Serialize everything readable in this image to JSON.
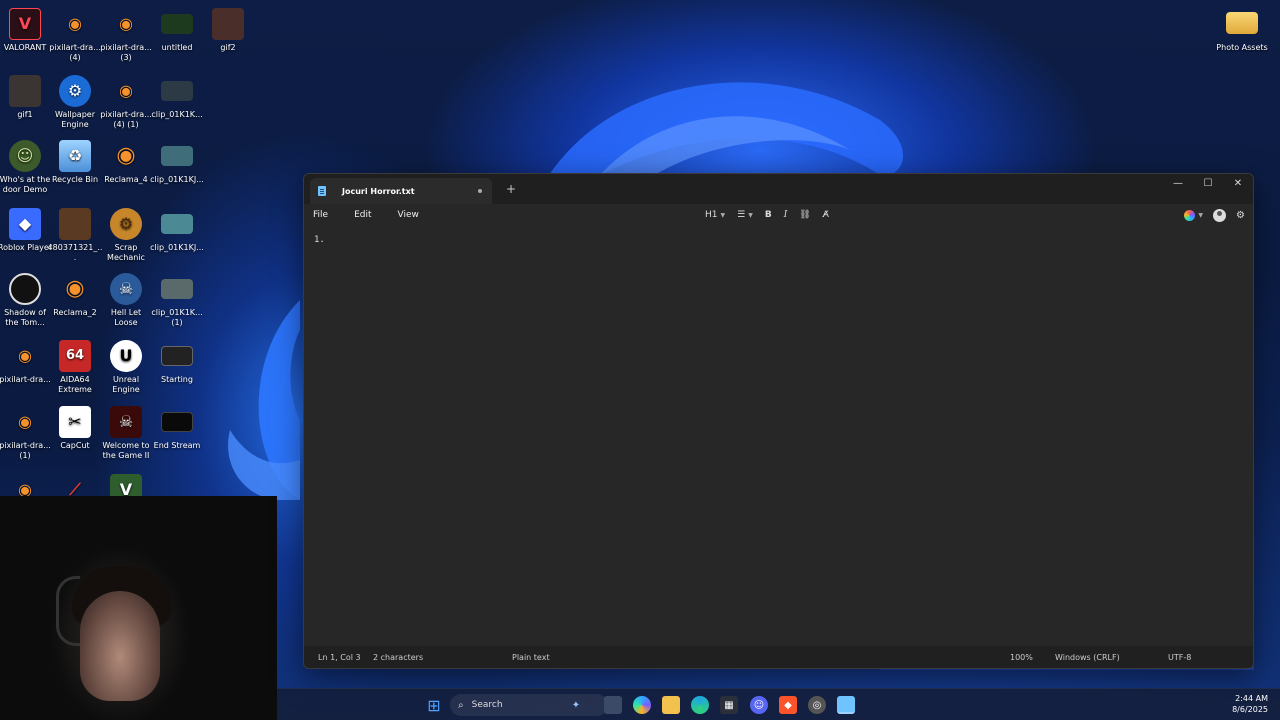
{
  "desktop": {
    "icons": [
      {
        "label": "VALORANT",
        "icon": "valorant-icon"
      },
      {
        "label": "pixilart-dra... (4)",
        "icon": "blender-icon"
      },
      {
        "label": "pixilart-dra... (3)",
        "icon": "blender-icon"
      },
      {
        "label": "untitled",
        "icon": "image-thumb"
      },
      {
        "label": "gif2",
        "icon": "image-thumb"
      },
      {
        "label": "gif1",
        "icon": "image-thumb"
      },
      {
        "label": "Wallpaper Engine",
        "icon": "wallpaper-engine-icon"
      },
      {
        "label": "pixilart-dra... (4) (1)",
        "icon": "blender-icon"
      },
      {
        "label": "clip_01K1K...",
        "icon": "video-thumb"
      },
      {
        "label": "Who's at the door Demo",
        "icon": "game-icon"
      },
      {
        "label": "Recycle Bin",
        "icon": "recycle-bin-icon"
      },
      {
        "label": "Reclama_4",
        "icon": "blender-icon"
      },
      {
        "label": "clip_01K1KJ...",
        "icon": "video-thumb"
      },
      {
        "label": "Roblox Player",
        "icon": "roblox-icon"
      },
      {
        "label": "480371321_...",
        "icon": "image-thumb"
      },
      {
        "label": "Scrap Mechanic",
        "icon": "scrap-mechanic-icon"
      },
      {
        "label": "clip_01K1KJ...",
        "icon": "video-thumb"
      },
      {
        "label": "Shadow of the Tom...",
        "icon": "game-icon"
      },
      {
        "label": "Reclama_2",
        "icon": "blender-icon"
      },
      {
        "label": "Hell Let Loose",
        "icon": "game-icon"
      },
      {
        "label": "clip_01K1K... (1)",
        "icon": "video-thumb"
      },
      {
        "label": "pixilart-dra...",
        "icon": "blender-icon"
      },
      {
        "label": "AIDA64 Extreme",
        "icon": "aida64-icon"
      },
      {
        "label": "Unreal Engine",
        "icon": "unreal-engine-icon"
      },
      {
        "label": "Starting",
        "icon": "video-thumb"
      },
      {
        "label": "pixilart-dra... (1)",
        "icon": "blender-icon"
      },
      {
        "label": "CapCut",
        "icon": "capcut-icon"
      },
      {
        "label": "Welcome to the Game II",
        "icon": "game-icon"
      },
      {
        "label": "End Stream",
        "icon": "video-thumb"
      },
      {
        "label": "Photo Assets",
        "icon": "folder-icon"
      }
    ]
  },
  "notepad": {
    "tab_title": "Jocuri Horror.txt",
    "new_tab": "+",
    "menu": {
      "file": "File",
      "edit": "Edit",
      "view": "View"
    },
    "toolbar": {
      "heading": "H1",
      "bold": "B",
      "italic": "I"
    },
    "editor_text": "1.",
    "status": {
      "position": "Ln 1, Col 3",
      "characters": "2 characters",
      "format": "Plain text",
      "zoom": "100%",
      "line_ending": "Windows (CRLF)",
      "encoding": "UTF-8"
    }
  },
  "taskbar": {
    "search_label": "Search",
    "time": "2:44 AM",
    "date": "8/6/2025"
  }
}
